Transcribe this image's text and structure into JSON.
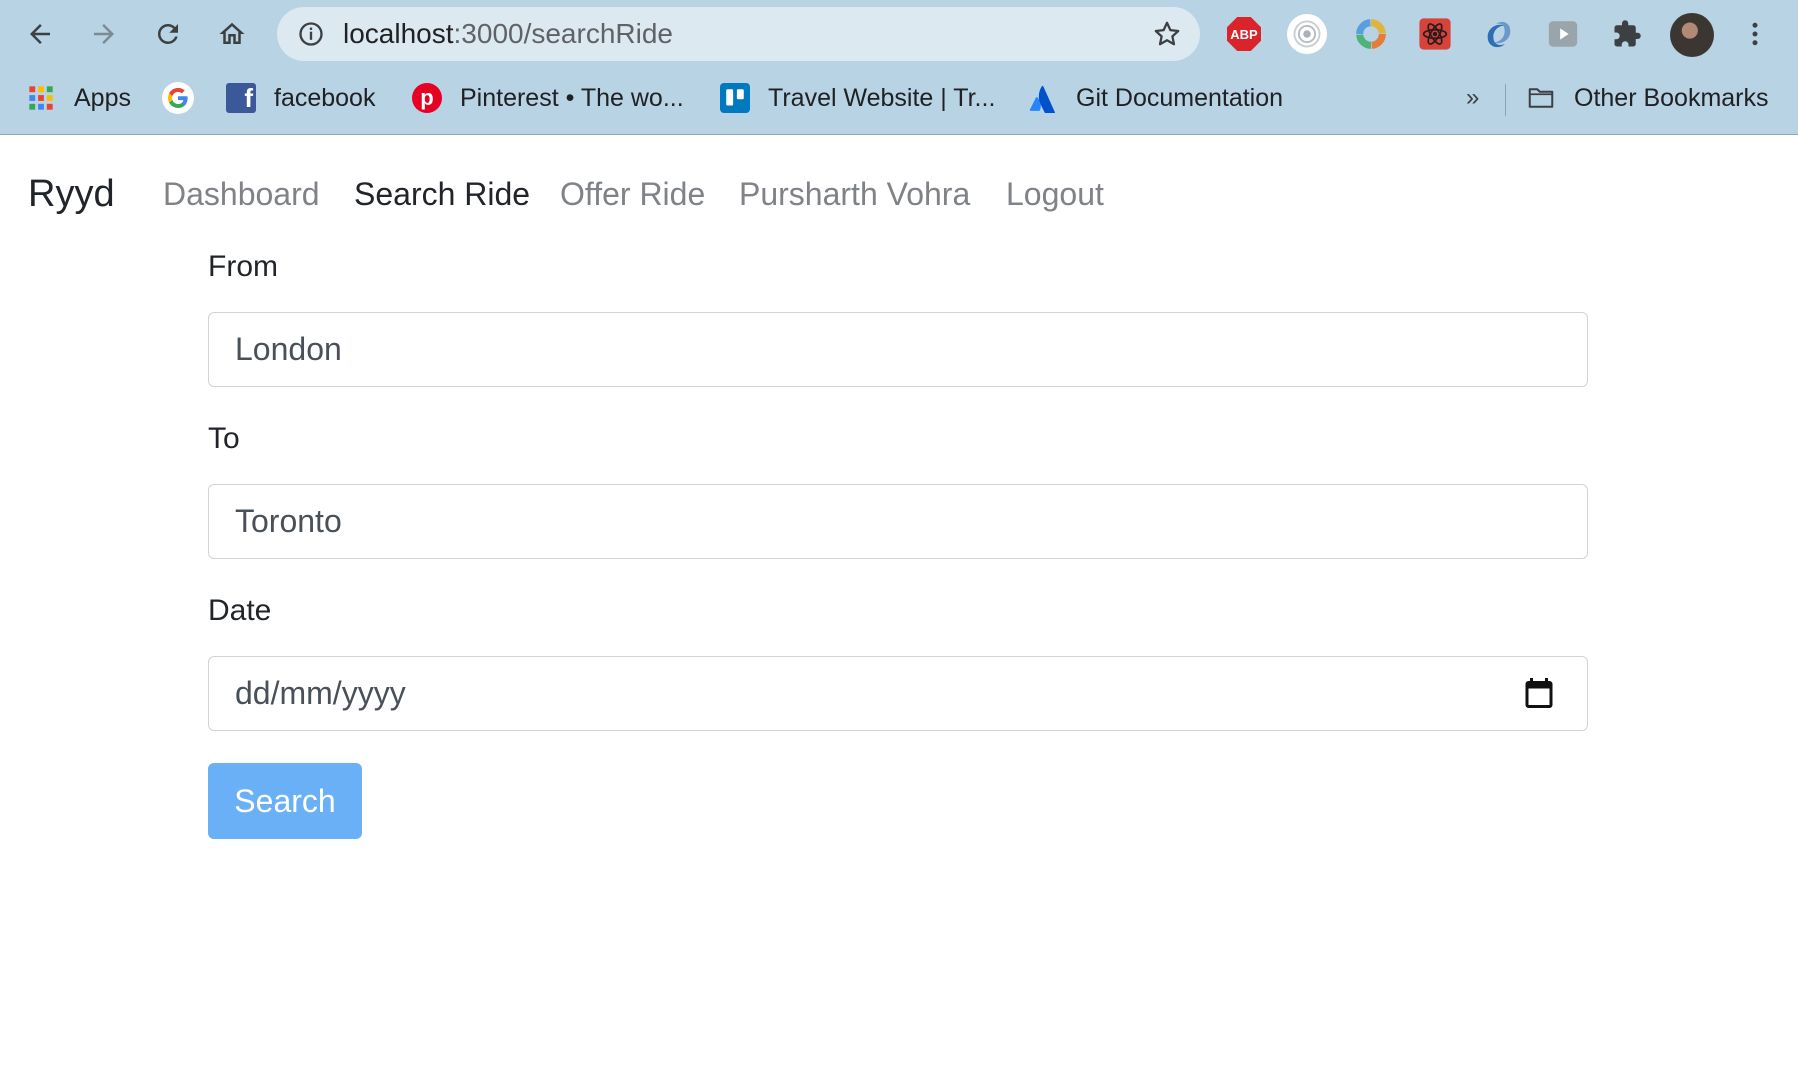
{
  "browser": {
    "url_host": "localhost",
    "url_path": ":3000/searchRide",
    "extensions": [
      "adblock-plus-icon",
      "target-icon",
      "colorwheel-icon",
      "react-devtools-icon",
      "swirl-icon",
      "play-icon",
      "puzzle-icon"
    ],
    "abp_label": "ABP",
    "bookmarks": {
      "apps": "Apps",
      "facebook": "facebook",
      "pinterest": "Pinterest • The wo...",
      "travel": "Travel Website | Tr...",
      "git": "Git Documentation",
      "overflow": "»",
      "other": "Other Bookmarks"
    }
  },
  "navbar": {
    "brand": "Ryyd",
    "links": [
      "Dashboard",
      "Search Ride",
      "Offer Ride",
      "Pursharth Vohra",
      "Logout"
    ],
    "active": "Search Ride"
  },
  "form": {
    "from_label": "From",
    "from_value": "London",
    "to_label": "To",
    "to_value": "Toronto",
    "date_label": "Date",
    "date_placeholder": "dd/mm/yyyy",
    "search_button": "Search"
  },
  "colors": {
    "chrome_bg": "#b8d3e4",
    "button_bg": "#6ab0f6",
    "nav_muted": "#7f8286"
  }
}
